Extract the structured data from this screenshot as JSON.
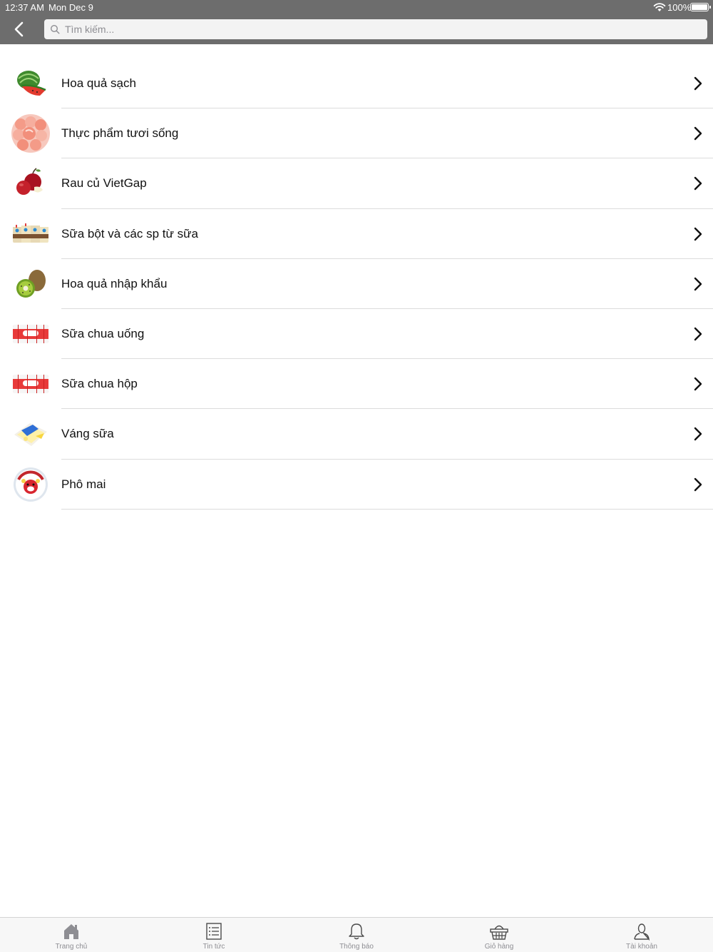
{
  "status_bar": {
    "time": "12:37 AM",
    "date": "Mon Dec 9",
    "battery_text": "100%"
  },
  "header": {
    "search_placeholder": "Tìm kiếm...",
    "background_color": "#6d6d6d"
  },
  "categories": [
    {
      "label": "Hoa quả sạch",
      "icon": "watermelon-thumbnail"
    },
    {
      "label": "Thực phẩm tươi sống",
      "icon": "shrimp-thumbnail"
    },
    {
      "label": "Rau củ VietGap",
      "icon": "apple-thumbnail"
    },
    {
      "label": "Sữa bột và các sp từ sữa",
      "icon": "milk-cartons-thumbnail"
    },
    {
      "label": "Hoa quả nhập khẩu",
      "icon": "kiwi-thumbnail"
    },
    {
      "label": "Sữa chua uống",
      "icon": "yogurt-drink-thumbnail"
    },
    {
      "label": "Sữa chua hộp",
      "icon": "yogurt-cups-thumbnail"
    },
    {
      "label": "Váng sữa",
      "icon": "cream-dessert-thumbnail"
    },
    {
      "label": "Phô mai",
      "icon": "cheese-thumbnail"
    }
  ],
  "tabbar": {
    "tabs": [
      {
        "label": "Trang chủ",
        "icon": "home-icon"
      },
      {
        "label": "Tin tức",
        "icon": "news-list-icon"
      },
      {
        "label": "Thông báo",
        "icon": "bell-icon"
      },
      {
        "label": "Giỏ hàng",
        "icon": "basket-icon"
      },
      {
        "label": "Tài khoản",
        "icon": "user-icon"
      }
    ]
  }
}
